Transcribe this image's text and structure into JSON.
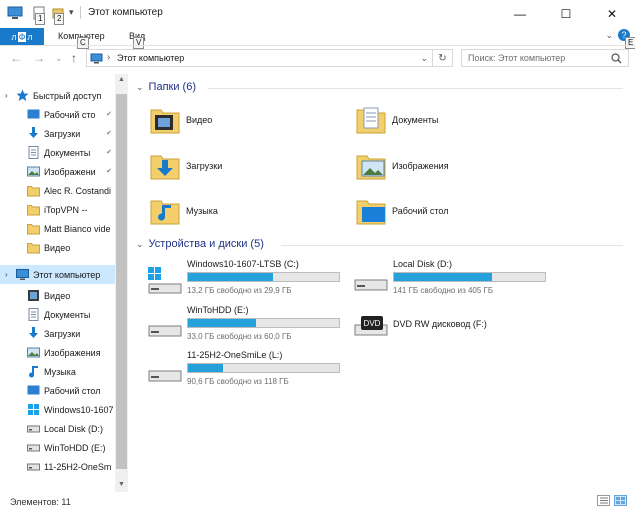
{
  "window": {
    "title": "Этот компьютер",
    "minimize_glyph": "—",
    "maximize_glyph": "☐",
    "close_glyph": "✕"
  },
  "keytips": {
    "qat1": "1",
    "qat2": "2",
    "computer": "C",
    "view": "V",
    "help": "E",
    "file": "Ф"
  },
  "ribbon": {
    "tab_file": "Ф",
    "tab_file_rest": "л",
    "tab_computer": "Компьютер",
    "tab_view": "Вид"
  },
  "address": {
    "back": "←",
    "forward": "→",
    "up": "↑",
    "separator": "›",
    "path": "Этот компьютер",
    "refresh": "↻",
    "search_placeholder": "Поиск: Этот компьютер"
  },
  "nav": {
    "items": [
      {
        "label": "Быстрый доступ",
        "icon": "star-icon"
      },
      {
        "label": "Рабочий сто",
        "icon": "desktop-icon",
        "pinned": true
      },
      {
        "label": "Загрузки",
        "icon": "download-icon",
        "pinned": true
      },
      {
        "label": "Документы",
        "icon": "documents-icon",
        "pinned": true
      },
      {
        "label": "Изображени",
        "icon": "pictures-icon",
        "pinned": true
      },
      {
        "label": "Alec R. Costandi",
        "icon": "folder-icon"
      },
      {
        "label": "iTopVPN --",
        "icon": "folder-icon"
      },
      {
        "label": "Matt Bianco vide",
        "icon": "folder-icon"
      },
      {
        "label": "Видео",
        "icon": "folder-icon"
      },
      {
        "label": "Этот компьютер",
        "icon": "computer-icon"
      },
      {
        "label": "Видео",
        "icon": "video-icon"
      },
      {
        "label": "Документы",
        "icon": "documents-icon"
      },
      {
        "label": "Загрузки",
        "icon": "download-icon"
      },
      {
        "label": "Изображения",
        "icon": "pictures-icon"
      },
      {
        "label": "Музыка",
        "icon": "music-icon"
      },
      {
        "label": "Рабочий стол",
        "icon": "desktop-icon"
      },
      {
        "label": "Windows10-1607",
        "icon": "windows-drive-icon"
      },
      {
        "label": "Local Disk (D:)",
        "icon": "drive-icon"
      },
      {
        "label": "WinToHDD (E:)",
        "icon": "drive-icon"
      },
      {
        "label": "11-25H2-OneSm",
        "icon": "drive-icon"
      }
    ]
  },
  "content": {
    "folders_header": "Папки (6)",
    "folders": [
      {
        "label": "Видео",
        "icon": "video-folder-icon"
      },
      {
        "label": "Документы",
        "icon": "documents-folder-icon"
      },
      {
        "label": "Загрузки",
        "icon": "downloads-folder-icon"
      },
      {
        "label": "Изображения",
        "icon": "pictures-folder-icon"
      },
      {
        "label": "Музыка",
        "icon": "music-folder-icon"
      },
      {
        "label": "Рабочий стол",
        "icon": "desktop-folder-icon"
      }
    ],
    "drives_header": "Устройства и диски (5)",
    "drives": [
      {
        "label": "Windows10-1607-LTSB (C:)",
        "free": "13,2 ГБ свободно из 29,9 ГБ",
        "used_fraction": 0.56,
        "icon": "windows-drive-icon"
      },
      {
        "label": "Local Disk (D:)",
        "free": "141 ГБ свободно из 405 ГБ",
        "used_fraction": 0.65,
        "icon": "drive-icon"
      },
      {
        "label": "WinToHDD (E:)",
        "free": "33,0 ГБ свободно из 60,0 ГБ",
        "used_fraction": 0.45,
        "icon": "drive-icon"
      },
      {
        "label": "DVD RW дисковод (F:)",
        "free": "",
        "used_fraction": null,
        "icon": "dvd-drive-icon",
        "badge": "DVD"
      },
      {
        "label": "11-25H2-OneSmiLe (L:)",
        "free": "90,6 ГБ свободно из 118 ГБ",
        "used_fraction": 0.23,
        "icon": "drive-icon"
      }
    ]
  },
  "status": {
    "items_count": "Элементов: 11"
  },
  "colors": {
    "accent": "#1979ca",
    "bar_fill": "#26a0da",
    "selection": "#cce8ff",
    "header_text": "#1e3287"
  }
}
